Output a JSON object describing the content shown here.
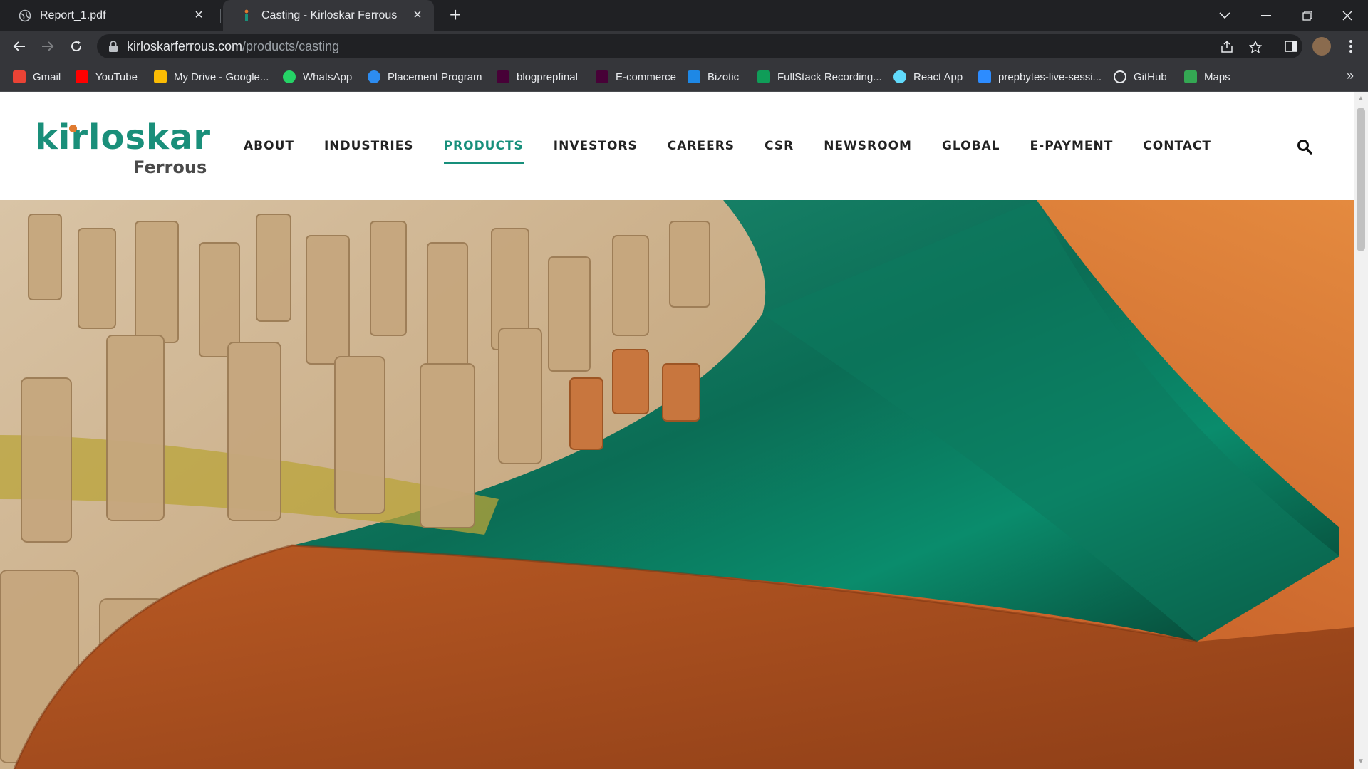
{
  "browser": {
    "tabs": [
      {
        "title": "Report_1.pdf",
        "active": false,
        "icon": "globe-icon"
      },
      {
        "title": "Casting - Kirloskar Ferrous",
        "active": true,
        "icon": "kirloskar-favicon"
      }
    ],
    "url_host": "kirloskarferrous.com",
    "url_path": "/products/casting",
    "bookmarks": [
      {
        "label": "Gmail",
        "icon": "gmail-icon",
        "color": "#ea4335"
      },
      {
        "label": "YouTube",
        "icon": "youtube-icon",
        "color": "#ff0000"
      },
      {
        "label": "My Drive - Google...",
        "icon": "drive-icon",
        "color": "#fbbc04"
      },
      {
        "label": "WhatsApp",
        "icon": "whatsapp-icon",
        "color": "#25d366"
      },
      {
        "label": "Placement Program",
        "icon": "pb-icon",
        "color": "#2d8cf0"
      },
      {
        "label": "blogprepfinal",
        "icon": "xd-icon",
        "color": "#470137"
      },
      {
        "label": "E-commerce",
        "icon": "xd-icon",
        "color": "#470137"
      },
      {
        "label": "Bizotic",
        "icon": "bizotic-icon",
        "color": "#1e88e5"
      },
      {
        "label": "FullStack Recording...",
        "icon": "sheets-icon",
        "color": "#0f9d58"
      },
      {
        "label": "React App",
        "icon": "react-icon",
        "color": "#61dafb"
      },
      {
        "label": "prepbytes-live-sessi...",
        "icon": "zoom-icon",
        "color": "#2d8cff"
      },
      {
        "label": "GitHub",
        "icon": "github-icon",
        "color": "#ffffff"
      },
      {
        "label": "Maps",
        "icon": "maps-icon",
        "color": "#34a853"
      }
    ]
  },
  "site": {
    "logo_text": "kirloskar",
    "logo_sub": "Ferrous",
    "nav": [
      "ABOUT",
      "INDUSTRIES",
      "PRODUCTS",
      "INVESTORS",
      "CAREERS",
      "CSR",
      "NEWSROOM",
      "GLOBAL",
      "E-PAYMENT",
      "CONTACT"
    ],
    "active_nav": "PRODUCTS",
    "accent": "#178f7b",
    "brand_orange": "#e07a2f"
  }
}
